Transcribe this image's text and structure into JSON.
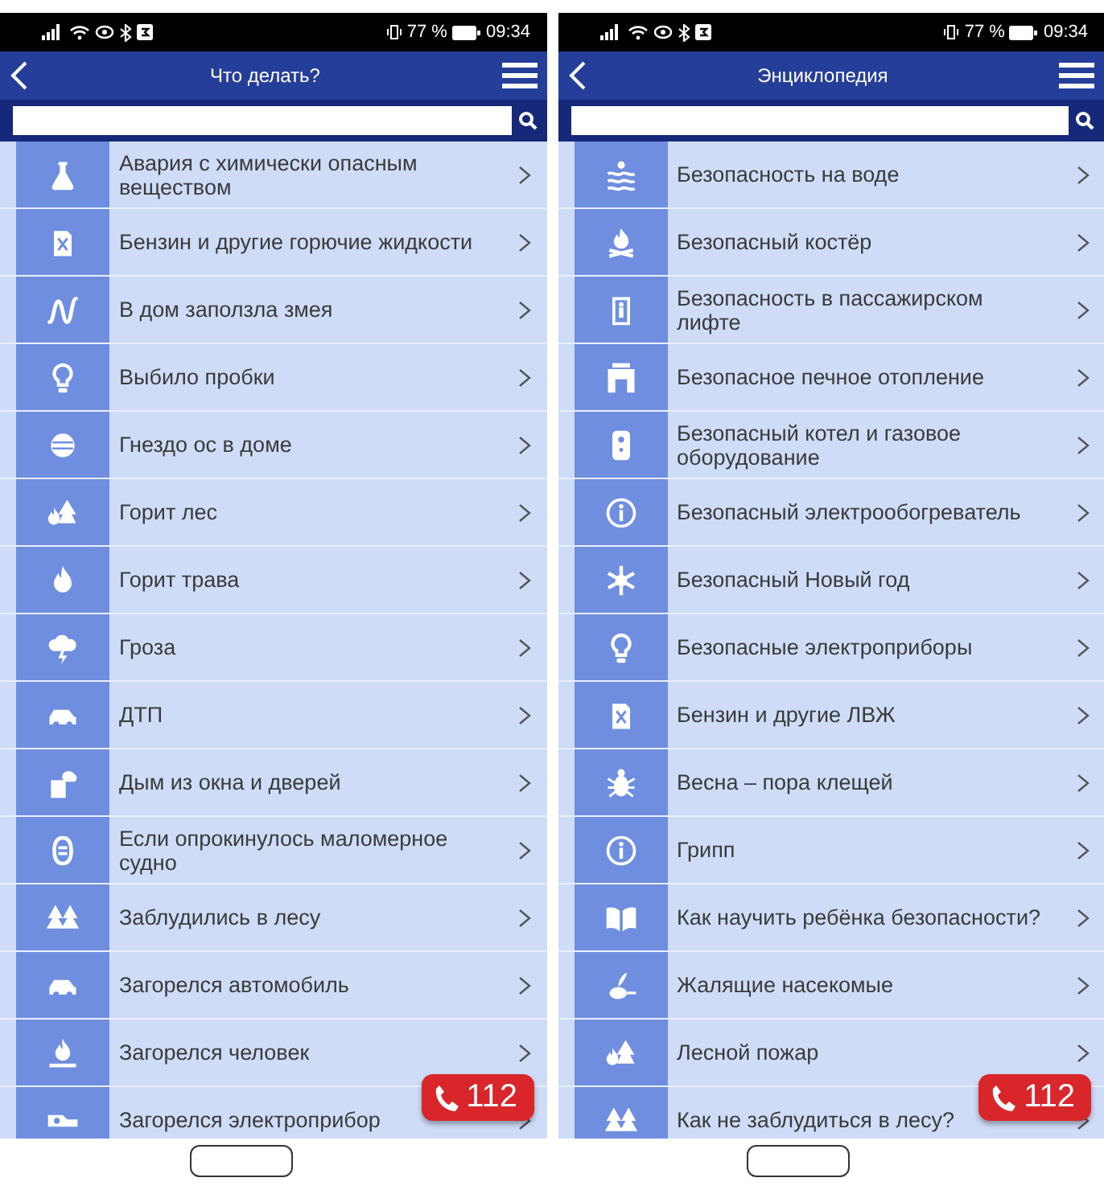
{
  "screens": [
    {
      "status": {
        "battery": "77 %",
        "time": "09:34"
      },
      "title": "Что делать?",
      "call_button": "112",
      "items": [
        {
          "label": "Авария с химически опасным веществом"
        },
        {
          "label": "Бензин и другие горючие жидкости"
        },
        {
          "label": "В дом заползла змея"
        },
        {
          "label": "Выбило пробки"
        },
        {
          "label": "Гнездо ос в доме"
        },
        {
          "label": "Горит лес"
        },
        {
          "label": "Горит трава"
        },
        {
          "label": "Гроза"
        },
        {
          "label": "ДТП"
        },
        {
          "label": "Дым из окна и дверей"
        },
        {
          "label": "Если опрокинулось маломерное судно"
        },
        {
          "label": "Заблудились в лесу"
        },
        {
          "label": "Загорелся автомобиль"
        },
        {
          "label": "Загорелся человек"
        },
        {
          "label": "Загорелся электроприбор"
        }
      ]
    },
    {
      "status": {
        "battery": "77 %",
        "time": "09:34"
      },
      "title": "Энциклопедия",
      "call_button": "112",
      "items": [
        {
          "label": "Безопасность на воде"
        },
        {
          "label": "Безопасный костёр"
        },
        {
          "label": "Безопасность в пассажирском лифте"
        },
        {
          "label": "Безопасное печное отопление"
        },
        {
          "label": "Безопасный котел и газовое оборудование"
        },
        {
          "label": "Безопасный электрообогреватель"
        },
        {
          "label": "Безопасный Новый год"
        },
        {
          "label": "Безопасные электроприборы"
        },
        {
          "label": "Бензин и другие ЛВЖ"
        },
        {
          "label": "Весна – пора клещей"
        },
        {
          "label": "Грипп"
        },
        {
          "label": "Как научить ребёнка безопасности?"
        },
        {
          "label": "Жалящие насекомые"
        },
        {
          "label": "Лесной пожар"
        },
        {
          "label": "Как не заблудиться в лесу?"
        }
      ]
    }
  ]
}
